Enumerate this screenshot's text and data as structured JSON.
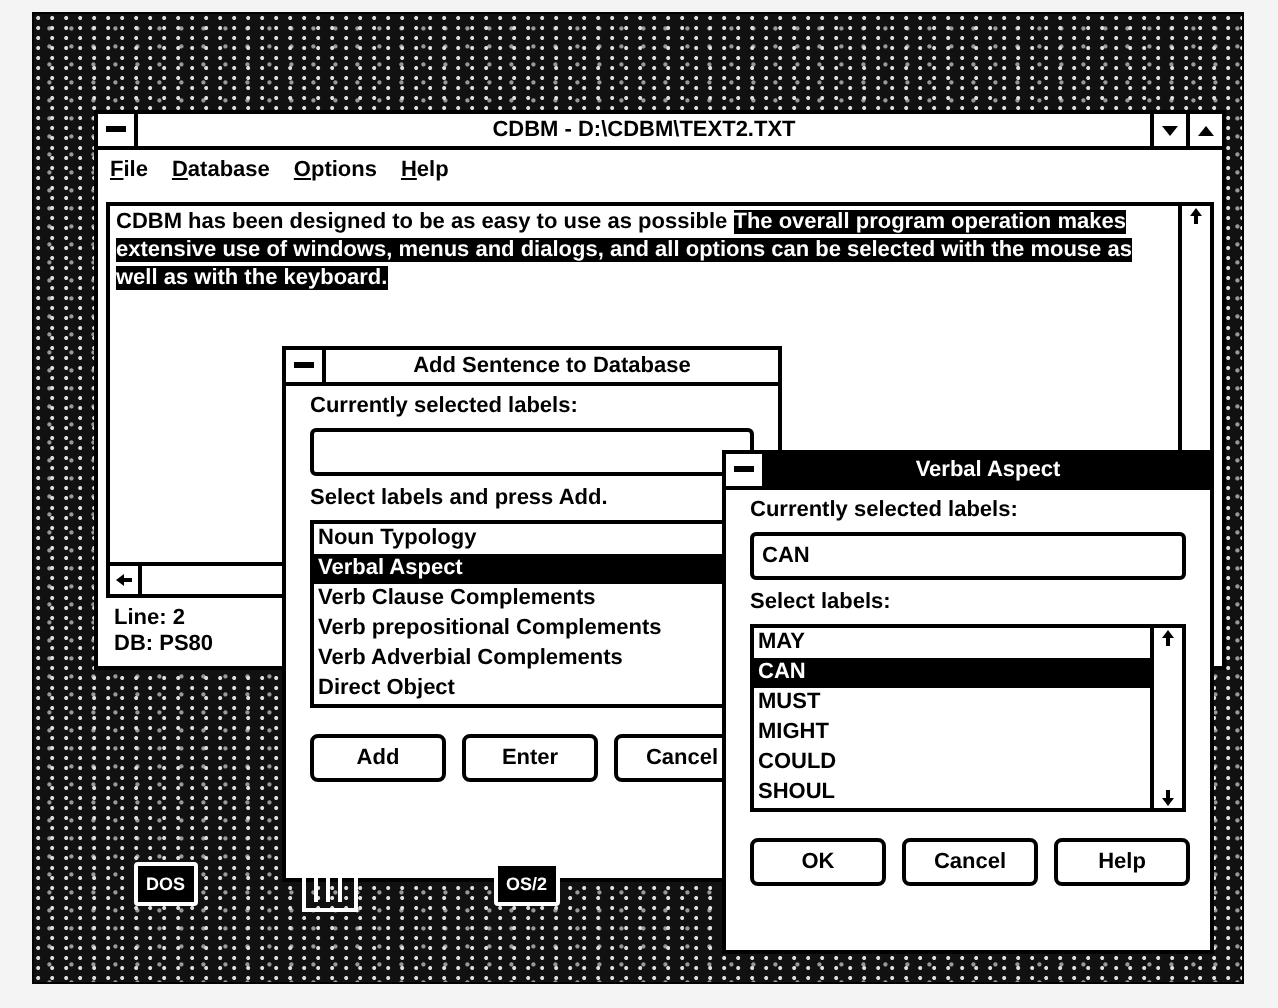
{
  "main_window": {
    "title": "CDBM - D:\\CDBM\\TEXT2.TXT",
    "active": false,
    "menu": [
      "File",
      "Database",
      "Options",
      "Help"
    ],
    "text": [
      {
        "text": "CDBM has been designed to be as easy to use as possible ",
        "selected": false
      },
      {
        "text": "The overall program operation makes extensive use of windows, menus and dialogs, and all options can be selected with the mouse as well as with the keyboard.",
        "selected": true
      }
    ],
    "status": [
      "Line: 2",
      "DB: PS80"
    ]
  },
  "add_dialog": {
    "title": "Add Sentence to Database",
    "active": false,
    "current_label": "Currently selected labels:",
    "list_label": "Select labels and press Add.",
    "items": [
      {
        "label": "Noun Typology",
        "selected": false
      },
      {
        "label": "Verbal Aspect",
        "selected": true
      },
      {
        "label": "Verb Clause Complements",
        "selected": false
      },
      {
        "label": "Verb prepositional Complements",
        "selected": false
      },
      {
        "label": "Verb Adverbial Complements",
        "selected": false
      },
      {
        "label": "Direct Object",
        "selected": false
      }
    ],
    "buttons": [
      "Add",
      "Enter",
      "Cancel"
    ]
  },
  "aspect_dialog": {
    "title": "Verbal Aspect",
    "active": true,
    "current_label": "Currently selected labels:",
    "current_value": "CAN",
    "list_label": "Select labels:",
    "items": [
      {
        "label": "MAY",
        "selected": false
      },
      {
        "label": "CAN",
        "selected": true
      },
      {
        "label": "MUST",
        "selected": false
      },
      {
        "label": "MIGHT",
        "selected": false
      },
      {
        "label": "COULD",
        "selected": false
      },
      {
        "label": "SHOUL",
        "selected": false
      }
    ],
    "buttons": [
      "OK",
      "Cancel",
      "Help"
    ]
  },
  "desktop_icons": [
    {
      "kind": "labelled",
      "label": "DOS"
    },
    {
      "kind": "drive"
    },
    {
      "kind": "labelled",
      "label": "OS/2"
    }
  ]
}
